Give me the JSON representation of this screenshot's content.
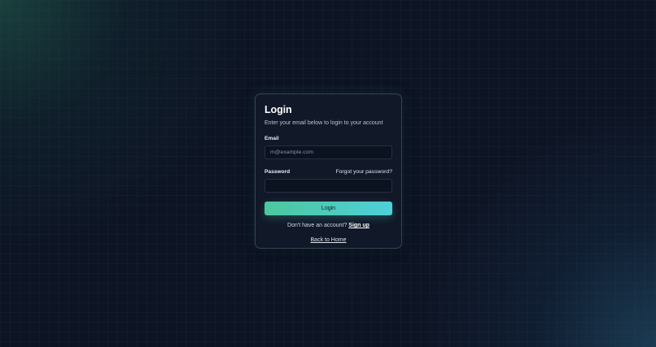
{
  "login_card": {
    "title": "Login",
    "subtitle": "Enter your email below to login to your account",
    "email": {
      "label": "Email",
      "placeholder": "m@example.com",
      "value": ""
    },
    "password": {
      "label": "Password",
      "forgot_link": "Forgot your password?",
      "value": ""
    },
    "submit_label": "Login",
    "signup_prompt": "Don't have an account?",
    "signup_link": "Sign up",
    "home_link": "Back to Home"
  },
  "colors": {
    "background": "#0d1424",
    "card": "#111928",
    "accent_start": "#4cc79d",
    "accent_end": "#4fcfd9"
  }
}
